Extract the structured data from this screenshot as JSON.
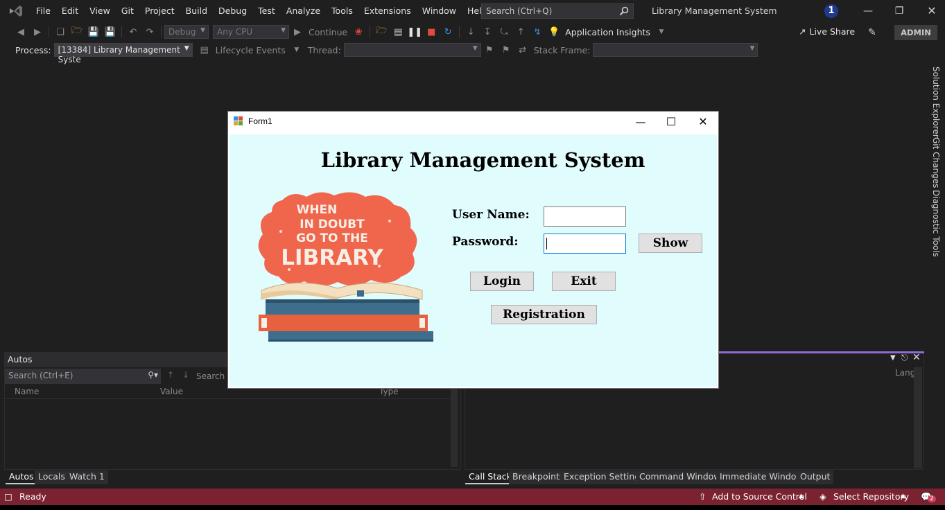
{
  "menu": [
    "File",
    "Edit",
    "View",
    "Git",
    "Project",
    "Build",
    "Debug",
    "Test",
    "Analyze",
    "Tools",
    "Extensions",
    "Window",
    "Help"
  ],
  "search": {
    "placeholder": "Search (Ctrl+Q)"
  },
  "app_title": "Library Management System",
  "notification_count": "1",
  "toolbar": {
    "config": "Debug",
    "platform": "Any CPU",
    "continue_label": "Continue",
    "app_insights": "Application Insights",
    "live_share": "Live Share",
    "user": "ADMIN"
  },
  "debugbar": {
    "process_label": "Process:",
    "process_value": "[13384] Library Management Syste",
    "lifecycle": "Lifecycle Events",
    "thread_label": "Thread:",
    "stack_frame_label": "Stack Frame:"
  },
  "side_tabs": [
    "Solution Explorer",
    "Git Changes",
    "Diagnostic Tools"
  ],
  "autos": {
    "title": "Autos",
    "search_placeholder": "Search (Ctrl+E)",
    "search_depth": "Search D",
    "columns": [
      "Name",
      "Value",
      "Type"
    ]
  },
  "callstack": {
    "column_lang": "Lang"
  },
  "bottom_tabs_left": [
    "Autos",
    "Locals",
    "Watch 1"
  ],
  "bottom_tabs_right": [
    "Call Stack",
    "Breakpoints",
    "Exception Settings",
    "Command Window",
    "Immediate Window",
    "Output"
  ],
  "status": {
    "ready": "Ready",
    "source_control": "Add to Source Control",
    "repository": "Select Repository",
    "badge": "2"
  },
  "form1": {
    "title": "Form1",
    "heading": "Library Management System",
    "username_label": "User Name:",
    "password_label": "Password:",
    "username_value": "",
    "password_value": "",
    "show_button": "Show",
    "login_button": "Login",
    "exit_button": "Exit",
    "registration_button": "Registration",
    "art_text": [
      "WHEN",
      "IN DOUBT",
      "GO TO THE",
      "LIBRARY"
    ]
  }
}
